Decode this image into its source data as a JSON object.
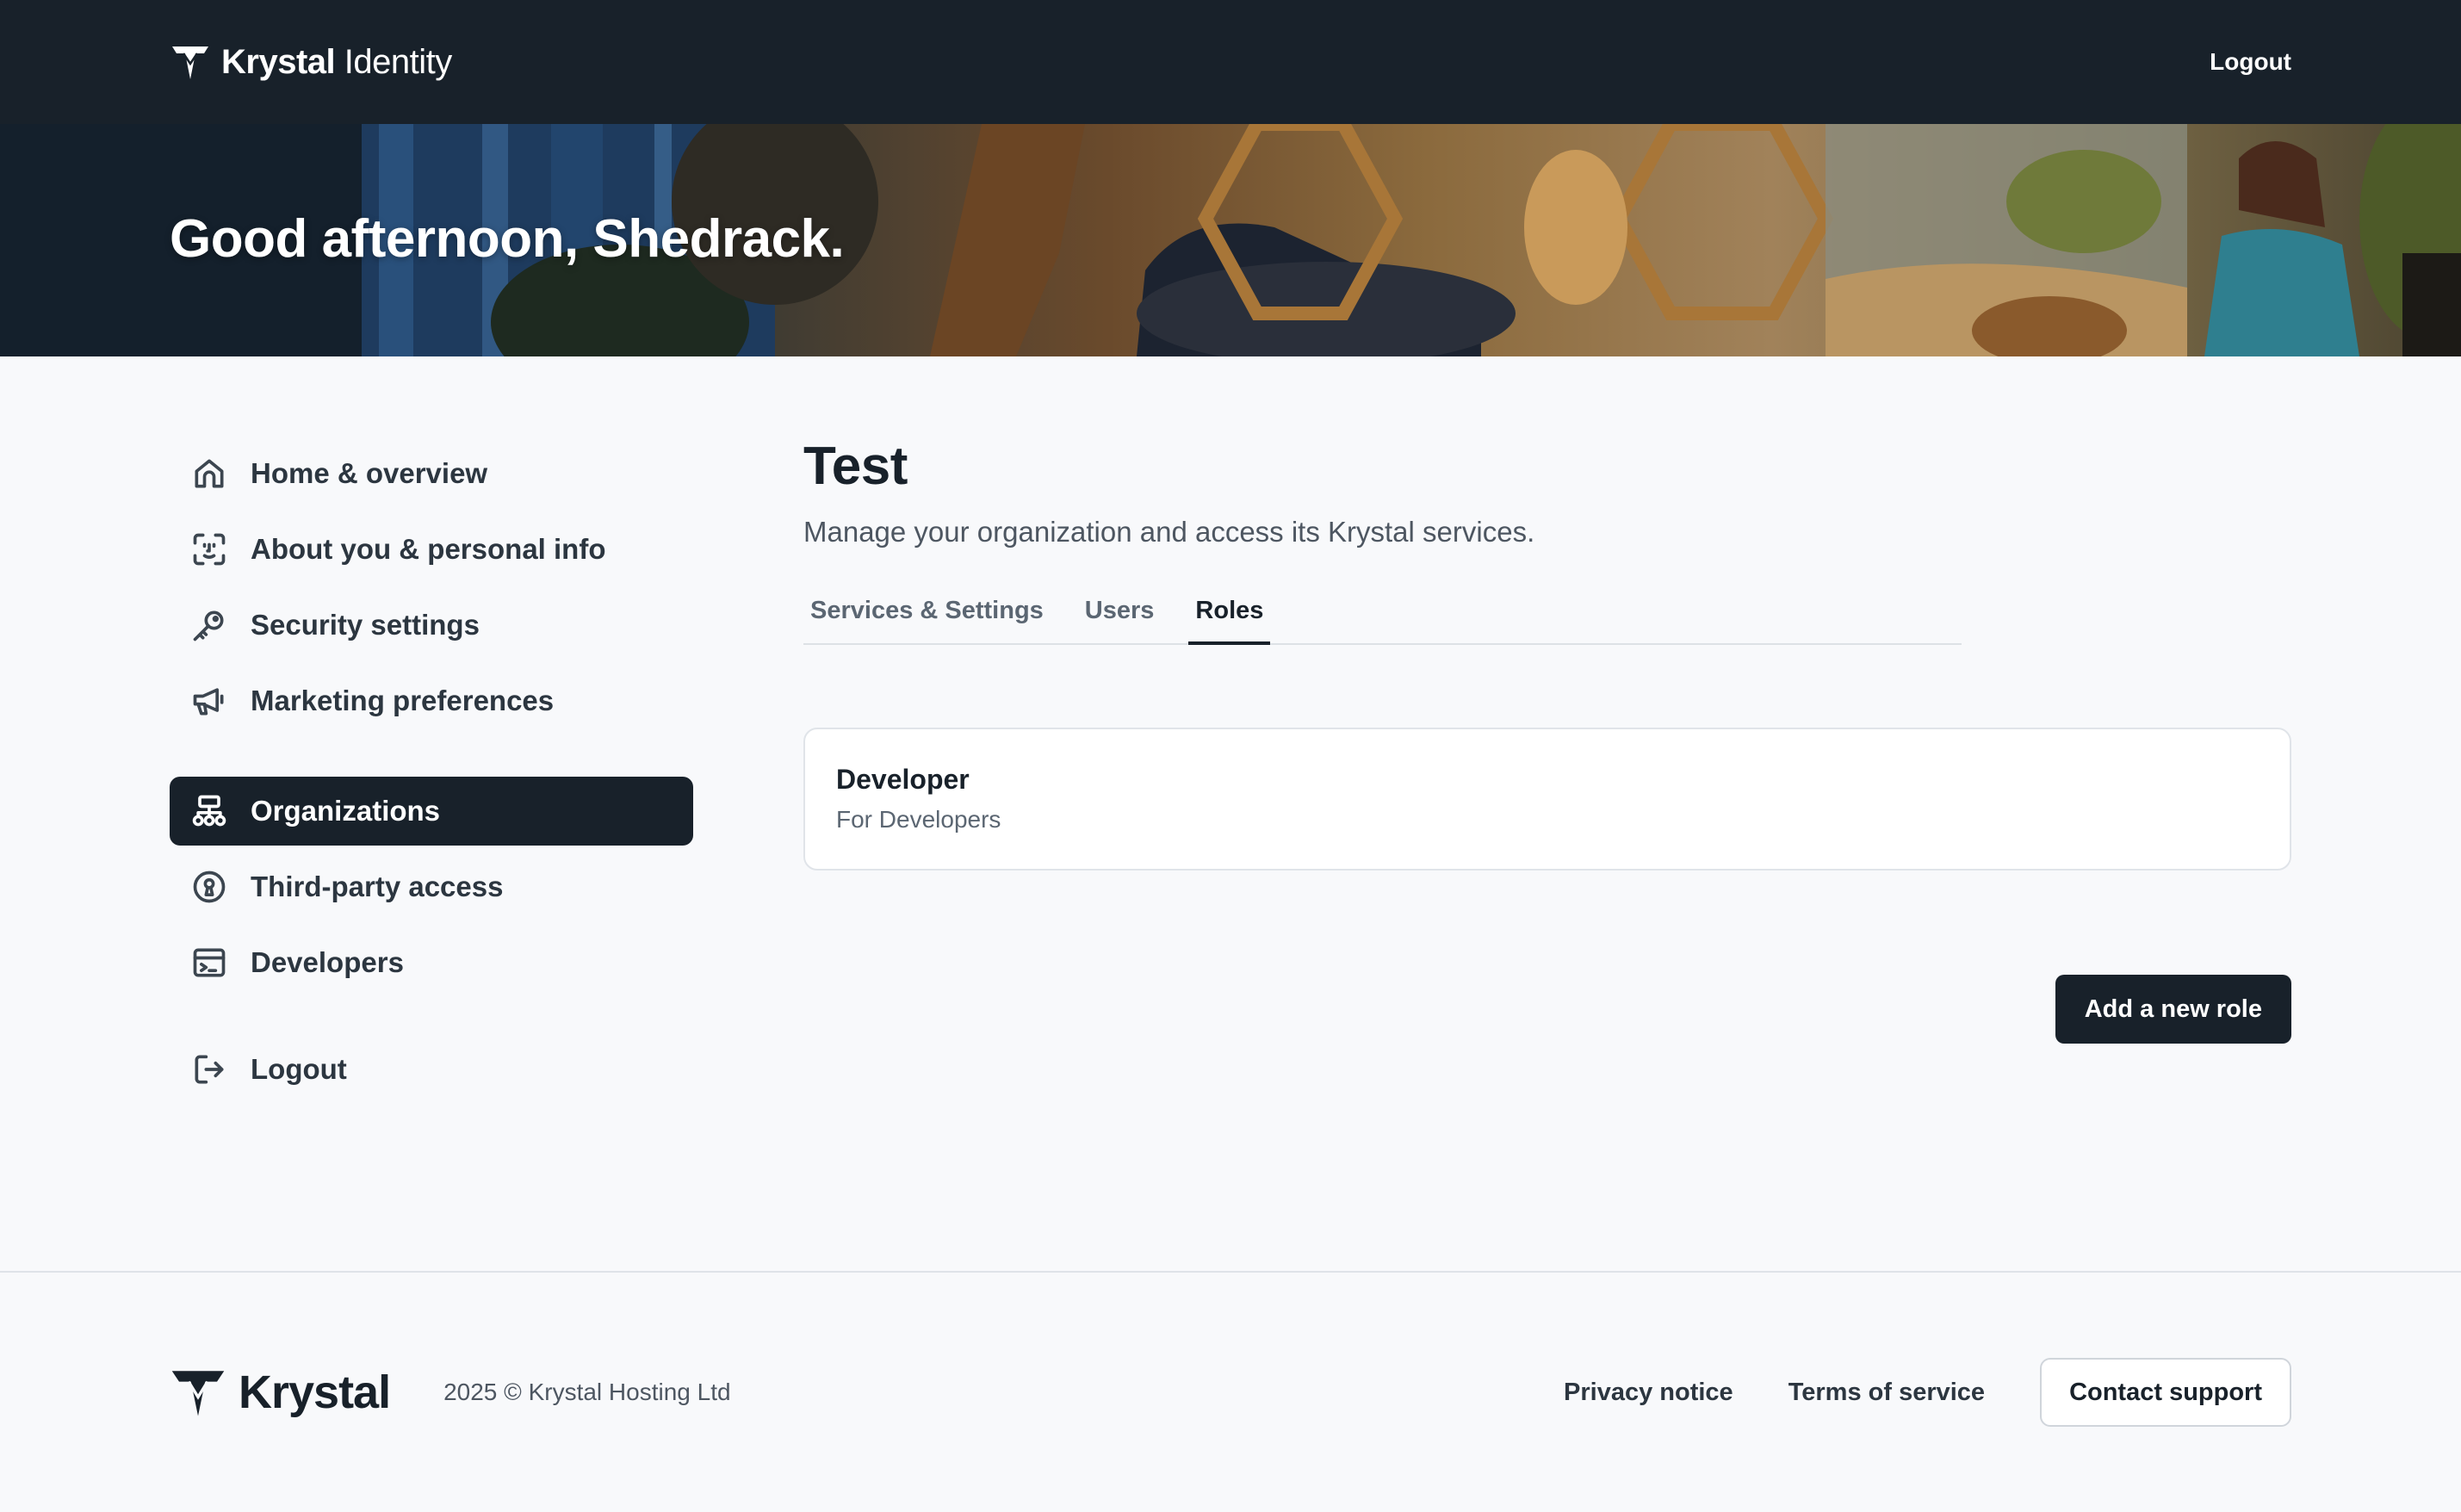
{
  "header": {
    "brand_bold": "Krystal",
    "brand_light": " Identity",
    "logout_label": "Logout"
  },
  "hero": {
    "greeting": "Good afternoon, Shedrack."
  },
  "sidebar": {
    "items": [
      {
        "label": "Home & overview",
        "icon": "home-icon"
      },
      {
        "label": "About you & personal info",
        "icon": "face-scan-icon"
      },
      {
        "label": "Security settings",
        "icon": "key-icon"
      },
      {
        "label": "Marketing preferences",
        "icon": "megaphone-icon"
      },
      {
        "label": "Organizations",
        "icon": "organization-icon",
        "active": true
      },
      {
        "label": "Third-party access",
        "icon": "keyhole-icon"
      },
      {
        "label": "Developers",
        "icon": "terminal-icon"
      },
      {
        "label": "Logout",
        "icon": "logout-icon"
      }
    ]
  },
  "main": {
    "title": "Test",
    "subtitle": "Manage your organization and access its Krystal services.",
    "tabs": [
      {
        "label": "Services & Settings"
      },
      {
        "label": "Users"
      },
      {
        "label": "Roles",
        "active": true
      }
    ],
    "roles": [
      {
        "name": "Developer",
        "description": "For Developers"
      }
    ],
    "add_role_label": "Add a new role"
  },
  "footer": {
    "brand": "Krystal",
    "copyright": "2025 © Krystal Hosting Ltd",
    "privacy_label": "Privacy notice",
    "terms_label": "Terms of service",
    "contact_label": "Contact support"
  },
  "colors": {
    "header_bg": "#18212a",
    "page_bg": "#f8f9fb",
    "active_nav_bg": "#18212a",
    "text_primary": "#18212a",
    "text_secondary": "#4d5661"
  }
}
